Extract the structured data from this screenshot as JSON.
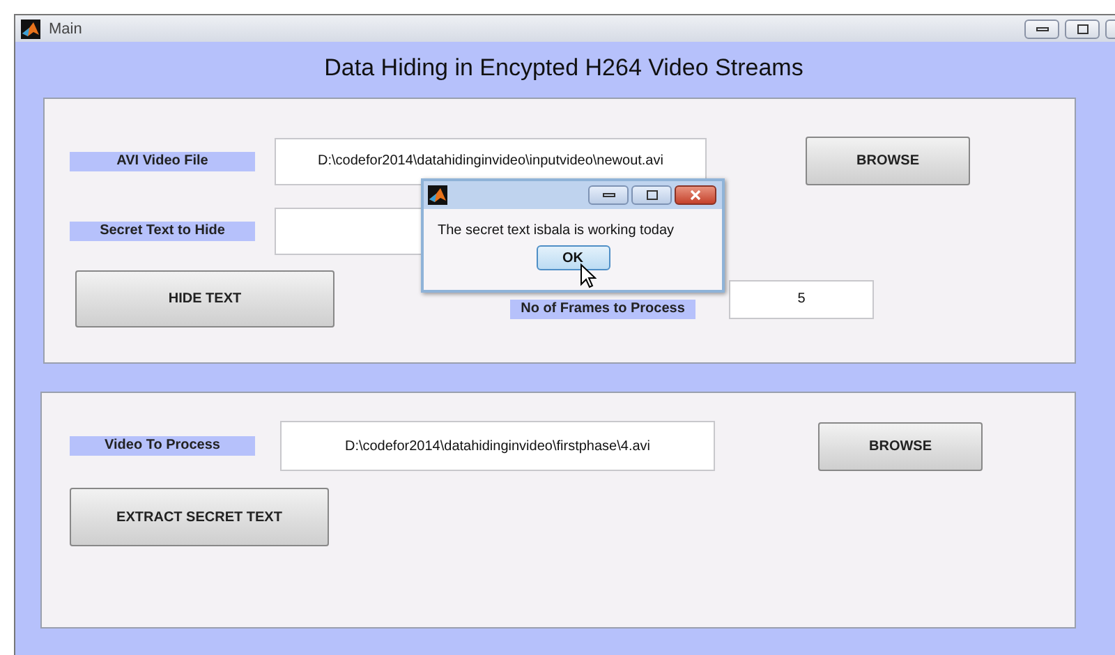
{
  "window": {
    "title": "Main"
  },
  "heading": "Data Hiding in Encypted H264 Video Streams",
  "hide_panel": {
    "video_label": "AVI Video File",
    "video_path": "D:\\codefor2014\\datahidinginvideo\\inputvideo\\newout.avi",
    "browse": "BROWSE",
    "secret_label": "Secret Text to Hide",
    "hide_button": "HIDE TEXT",
    "frames_label": "No of Frames to Process",
    "frames_value": "5"
  },
  "extract_panel": {
    "video_label": "Video To Process",
    "video_path": "D:\\codefor2014\\datahidinginvideo\\firstphase\\4.avi",
    "browse": "BROWSE",
    "extract_button": "EXTRACT SECRET TEXT"
  },
  "dialog": {
    "message": "The secret text isbala is working today",
    "ok": "OK"
  }
}
